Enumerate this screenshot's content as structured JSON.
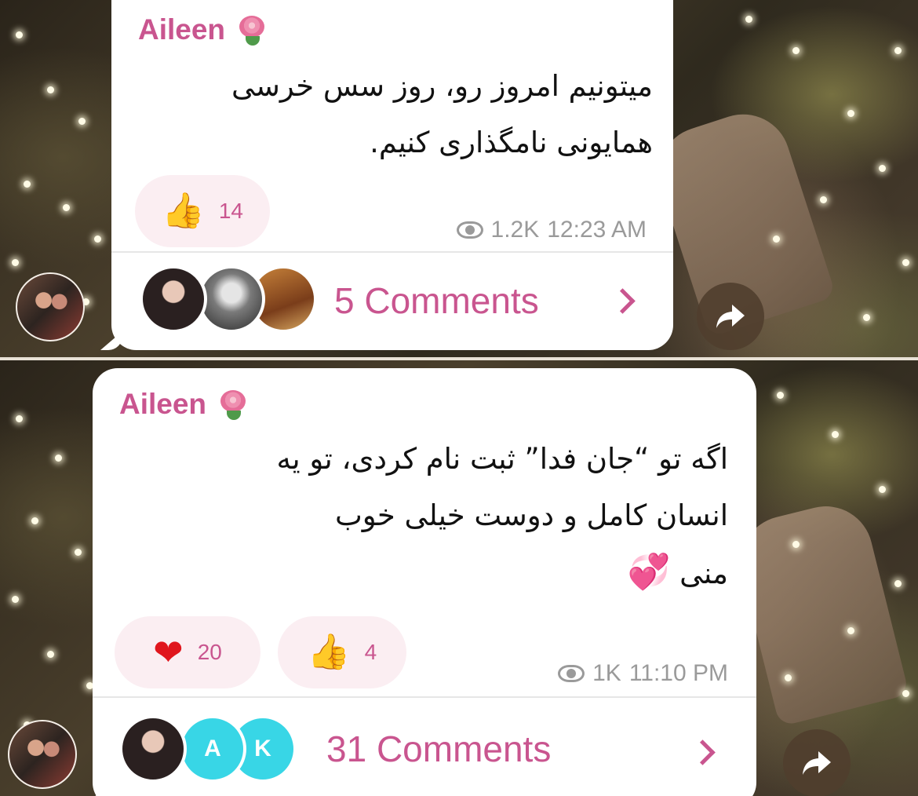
{
  "posts": [
    {
      "author": "Aileen",
      "message_lines": [
        "میتونیم امروز رو، روز سس خرسی",
        "همایونی نامگذاری کنیم."
      ],
      "reactions": [
        {
          "emoji": "👍",
          "count": "14"
        }
      ],
      "views": "1.2K",
      "time": "12:23 AM",
      "comments_label": "5 Comments",
      "commenter_initials": [
        "",
        "",
        ""
      ]
    },
    {
      "author": "Aileen",
      "message_lines": [
        "اگه تو “جان فدا” ثبت نام کردی، تو یه",
        "انسان کامل و دوست خیلی خوب",
        "منی"
      ],
      "message_emoji": "💞",
      "reactions": [
        {
          "emoji": "❤",
          "count": "20"
        },
        {
          "emoji": "👍",
          "count": "4"
        }
      ],
      "views": "1K",
      "time": "11:10 PM",
      "comments_label": "31 Comments",
      "commenter_initials": [
        "",
        "A",
        "K"
      ]
    }
  ],
  "icons": {
    "author_badge": "rose-icon",
    "views": "eye-icon",
    "comments": "chevron-right-icon",
    "share": "share-arrow-icon"
  },
  "colors": {
    "accent": "#c9558f",
    "reaction_bg": "#fbeef2",
    "meta_text": "#9a9a9a",
    "avatar_cyan": "#38d6e6"
  }
}
